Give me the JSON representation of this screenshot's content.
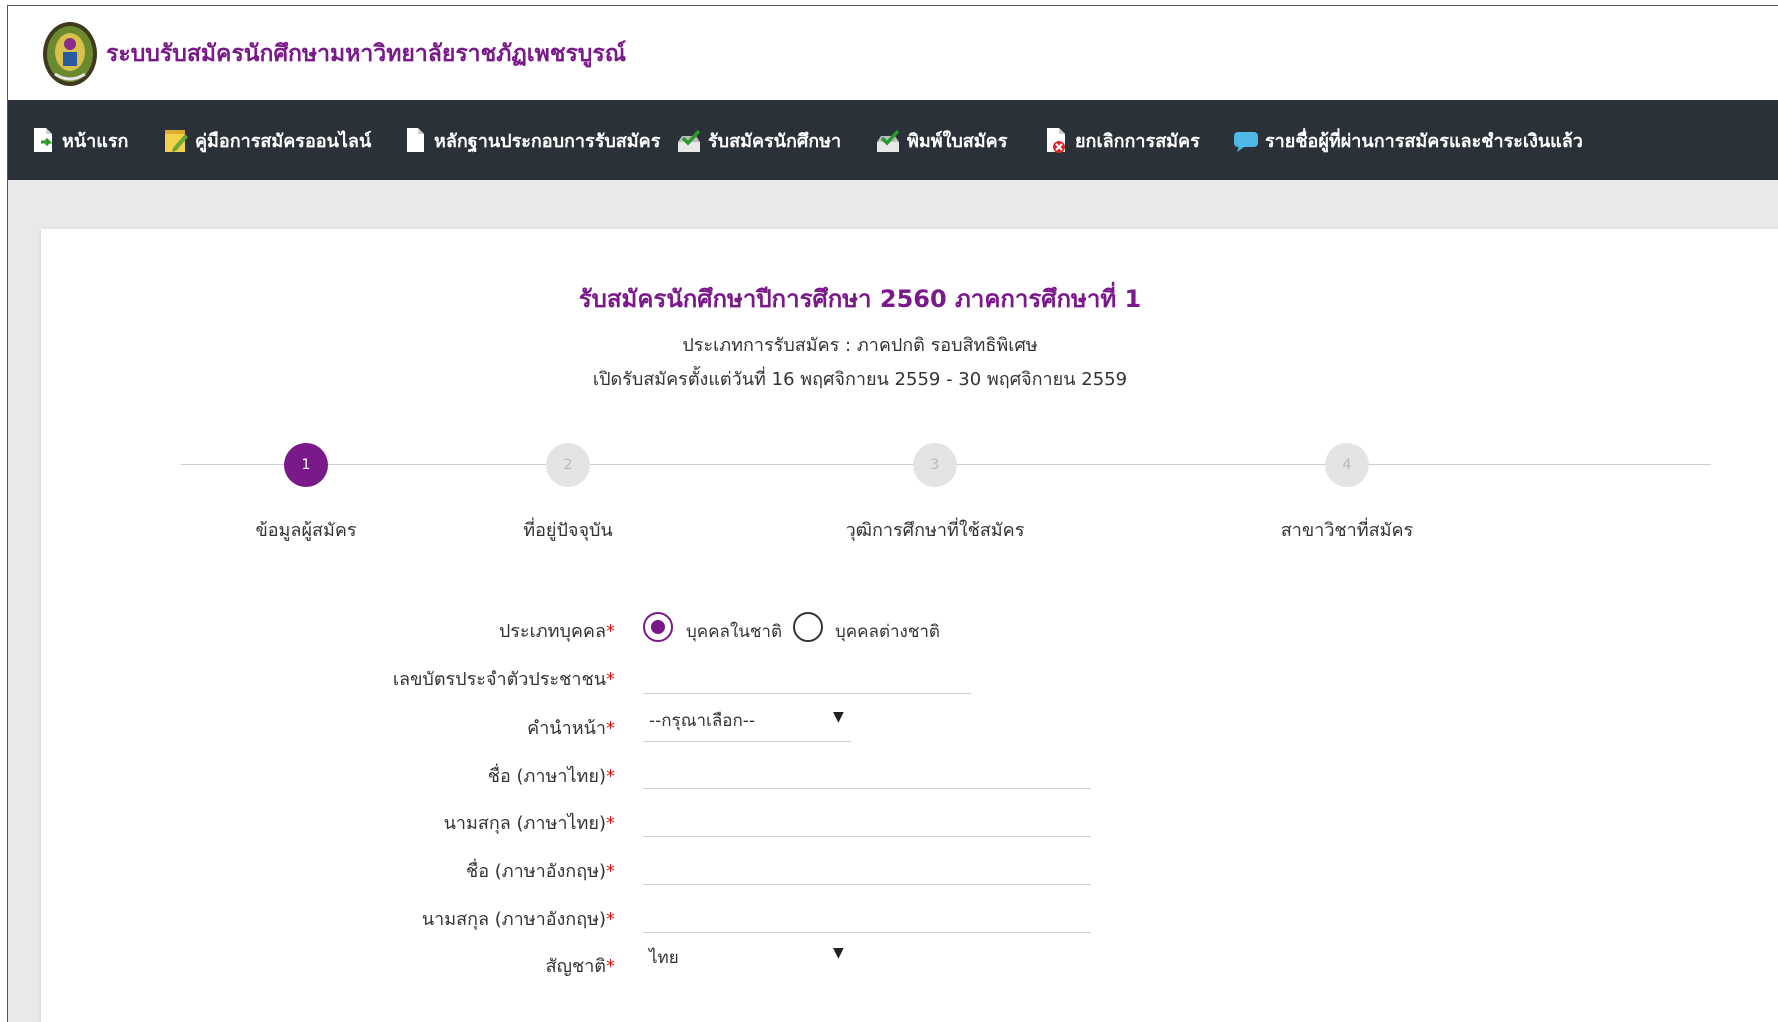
{
  "header": {
    "site_title": "ระบบรับสมัครนักศึกษามหาวิทยาลัยราชภัฏเพชรบูรณ์"
  },
  "nav": {
    "items": [
      {
        "label": "หน้าแรก",
        "icon": "page-arrow-icon"
      },
      {
        "label": "คู่มือการสมัครออนไลน์",
        "icon": "notepad-edit-icon"
      },
      {
        "label": "หลักฐานประกอบการรับสมัคร",
        "icon": "document-icon"
      },
      {
        "label": "รับสมัครนักศึกษา",
        "icon": "inbox-check-icon"
      },
      {
        "label": "พิมพ์ใบสมัคร",
        "icon": "inbox-check-icon"
      },
      {
        "label": "ยกเลิกการสมัคร",
        "icon": "document-delete-icon"
      },
      {
        "label": "รายชื่อผู้ที่ผ่านการสมัครและชำระเงินแล้ว",
        "icon": "speech-bubble-icon"
      }
    ]
  },
  "card": {
    "title": "รับสมัครนักศึกษาปีการศึกษา 2560 ภาคการศึกษาที่ 1",
    "application_type": "ประเภทการรับสมัคร : ภาคปกติ รอบสิทธิพิเศษ",
    "open_period": "เปิดรับสมัครตั้งแต่วันที่ 16 พฤศจิกายน 2559 - 30 พฤศจิกายน 2559"
  },
  "steps": [
    {
      "number": "1",
      "label": "ข้อมูลผู้สมัคร",
      "active": true
    },
    {
      "number": "2",
      "label": "ที่อยู่ปัจจุบัน",
      "active": false
    },
    {
      "number": "3",
      "label": "วุฒิการศึกษาที่ใช้สมัคร",
      "active": false
    },
    {
      "number": "4",
      "label": "สาขาวิชาที่สมัคร",
      "active": false
    }
  ],
  "form": {
    "person_type": {
      "label": "ประเภทบุคคล",
      "required_mark": "*",
      "options": [
        "บุคคลในชาติ",
        "บุคคลต่างชาติ"
      ],
      "selected": "บุคคลในชาติ"
    },
    "citizen_id": {
      "label": "เลขบัตรประจำตัวประชาชน",
      "required_mark": "*",
      "value": ""
    },
    "prefix": {
      "label": "คำนำหน้า",
      "required_mark": "*",
      "value": "--กรุณาเลือก--"
    },
    "first_name_th": {
      "label": "ชื่อ (ภาษาไทย)",
      "required_mark": "*",
      "value": ""
    },
    "last_name_th": {
      "label": "นามสกุล (ภาษาไทย)",
      "required_mark": "*",
      "value": ""
    },
    "first_name_en": {
      "label": "ชื่อ (ภาษาอังกฤษ)",
      "required_mark": "*",
      "value": ""
    },
    "last_name_en": {
      "label": "นามสกุล (ภาษาอังกฤษ)",
      "required_mark": "*",
      "value": ""
    },
    "nationality": {
      "label": "สัญชาติ",
      "required_mark": "*",
      "value": "ไทย"
    }
  },
  "colors": {
    "accent": "#7a1a8a",
    "navbar": "#2b3138",
    "required": "#d21b1b",
    "page_bg": "#e9e9e9"
  }
}
